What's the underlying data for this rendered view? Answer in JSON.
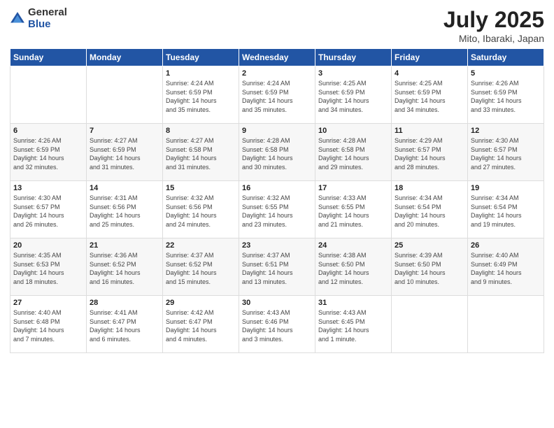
{
  "logo": {
    "general": "General",
    "blue": "Blue"
  },
  "title": "July 2025",
  "subtitle": "Mito, Ibaraki, Japan",
  "weekdays": [
    "Sunday",
    "Monday",
    "Tuesday",
    "Wednesday",
    "Thursday",
    "Friday",
    "Saturday"
  ],
  "weeks": [
    [
      {
        "day": "",
        "detail": ""
      },
      {
        "day": "",
        "detail": ""
      },
      {
        "day": "1",
        "detail": "Sunrise: 4:24 AM\nSunset: 6:59 PM\nDaylight: 14 hours\nand 35 minutes."
      },
      {
        "day": "2",
        "detail": "Sunrise: 4:24 AM\nSunset: 6:59 PM\nDaylight: 14 hours\nand 35 minutes."
      },
      {
        "day": "3",
        "detail": "Sunrise: 4:25 AM\nSunset: 6:59 PM\nDaylight: 14 hours\nand 34 minutes."
      },
      {
        "day": "4",
        "detail": "Sunrise: 4:25 AM\nSunset: 6:59 PM\nDaylight: 14 hours\nand 34 minutes."
      },
      {
        "day": "5",
        "detail": "Sunrise: 4:26 AM\nSunset: 6:59 PM\nDaylight: 14 hours\nand 33 minutes."
      }
    ],
    [
      {
        "day": "6",
        "detail": "Sunrise: 4:26 AM\nSunset: 6:59 PM\nDaylight: 14 hours\nand 32 minutes."
      },
      {
        "day": "7",
        "detail": "Sunrise: 4:27 AM\nSunset: 6:59 PM\nDaylight: 14 hours\nand 31 minutes."
      },
      {
        "day": "8",
        "detail": "Sunrise: 4:27 AM\nSunset: 6:58 PM\nDaylight: 14 hours\nand 31 minutes."
      },
      {
        "day": "9",
        "detail": "Sunrise: 4:28 AM\nSunset: 6:58 PM\nDaylight: 14 hours\nand 30 minutes."
      },
      {
        "day": "10",
        "detail": "Sunrise: 4:28 AM\nSunset: 6:58 PM\nDaylight: 14 hours\nand 29 minutes."
      },
      {
        "day": "11",
        "detail": "Sunrise: 4:29 AM\nSunset: 6:57 PM\nDaylight: 14 hours\nand 28 minutes."
      },
      {
        "day": "12",
        "detail": "Sunrise: 4:30 AM\nSunset: 6:57 PM\nDaylight: 14 hours\nand 27 minutes."
      }
    ],
    [
      {
        "day": "13",
        "detail": "Sunrise: 4:30 AM\nSunset: 6:57 PM\nDaylight: 14 hours\nand 26 minutes."
      },
      {
        "day": "14",
        "detail": "Sunrise: 4:31 AM\nSunset: 6:56 PM\nDaylight: 14 hours\nand 25 minutes."
      },
      {
        "day": "15",
        "detail": "Sunrise: 4:32 AM\nSunset: 6:56 PM\nDaylight: 14 hours\nand 24 minutes."
      },
      {
        "day": "16",
        "detail": "Sunrise: 4:32 AM\nSunset: 6:55 PM\nDaylight: 14 hours\nand 23 minutes."
      },
      {
        "day": "17",
        "detail": "Sunrise: 4:33 AM\nSunset: 6:55 PM\nDaylight: 14 hours\nand 21 minutes."
      },
      {
        "day": "18",
        "detail": "Sunrise: 4:34 AM\nSunset: 6:54 PM\nDaylight: 14 hours\nand 20 minutes."
      },
      {
        "day": "19",
        "detail": "Sunrise: 4:34 AM\nSunset: 6:54 PM\nDaylight: 14 hours\nand 19 minutes."
      }
    ],
    [
      {
        "day": "20",
        "detail": "Sunrise: 4:35 AM\nSunset: 6:53 PM\nDaylight: 14 hours\nand 18 minutes."
      },
      {
        "day": "21",
        "detail": "Sunrise: 4:36 AM\nSunset: 6:52 PM\nDaylight: 14 hours\nand 16 minutes."
      },
      {
        "day": "22",
        "detail": "Sunrise: 4:37 AM\nSunset: 6:52 PM\nDaylight: 14 hours\nand 15 minutes."
      },
      {
        "day": "23",
        "detail": "Sunrise: 4:37 AM\nSunset: 6:51 PM\nDaylight: 14 hours\nand 13 minutes."
      },
      {
        "day": "24",
        "detail": "Sunrise: 4:38 AM\nSunset: 6:50 PM\nDaylight: 14 hours\nand 12 minutes."
      },
      {
        "day": "25",
        "detail": "Sunrise: 4:39 AM\nSunset: 6:50 PM\nDaylight: 14 hours\nand 10 minutes."
      },
      {
        "day": "26",
        "detail": "Sunrise: 4:40 AM\nSunset: 6:49 PM\nDaylight: 14 hours\nand 9 minutes."
      }
    ],
    [
      {
        "day": "27",
        "detail": "Sunrise: 4:40 AM\nSunset: 6:48 PM\nDaylight: 14 hours\nand 7 minutes."
      },
      {
        "day": "28",
        "detail": "Sunrise: 4:41 AM\nSunset: 6:47 PM\nDaylight: 14 hours\nand 6 minutes."
      },
      {
        "day": "29",
        "detail": "Sunrise: 4:42 AM\nSunset: 6:47 PM\nDaylight: 14 hours\nand 4 minutes."
      },
      {
        "day": "30",
        "detail": "Sunrise: 4:43 AM\nSunset: 6:46 PM\nDaylight: 14 hours\nand 3 minutes."
      },
      {
        "day": "31",
        "detail": "Sunrise: 4:43 AM\nSunset: 6:45 PM\nDaylight: 14 hours\nand 1 minute."
      },
      {
        "day": "",
        "detail": ""
      },
      {
        "day": "",
        "detail": ""
      }
    ]
  ]
}
